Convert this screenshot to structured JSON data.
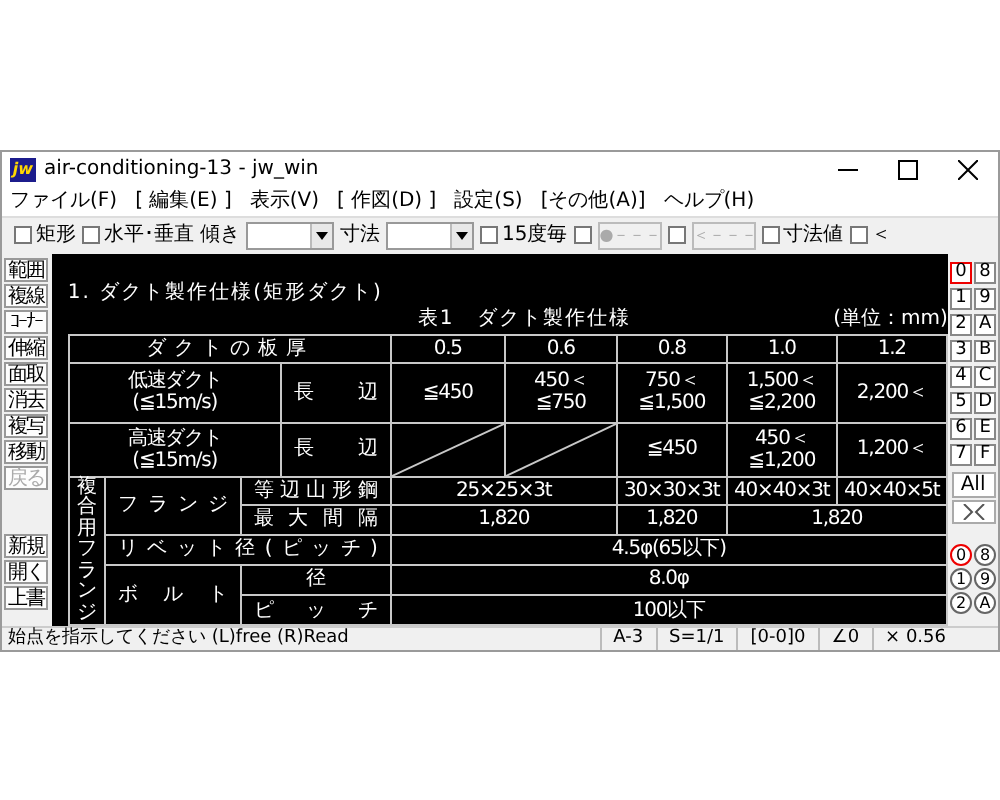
{
  "window": {
    "title": "air-conditioning-13 - jw_win",
    "icon_text": "jw"
  },
  "menu": [
    "ファイル(F)",
    "[ 編集(E) ]",
    "表示(V)",
    "[ 作図(D) ]",
    "設定(S)",
    "[その他(A)]",
    "ヘルプ(H)"
  ],
  "toolbar": [
    {
      "kind": "checkbox",
      "label": "矩形",
      "checked": false
    },
    {
      "kind": "checkbox",
      "label": "水平･垂直",
      "checked": false
    },
    {
      "kind": "label",
      "text": "傾き"
    },
    {
      "kind": "select"
    },
    {
      "kind": "label",
      "text": "寸法"
    },
    {
      "kind": "select"
    },
    {
      "kind": "checkbox",
      "label": "15度毎",
      "checked": false
    },
    {
      "kind": "checkbox",
      "checked": false
    },
    {
      "kind": "button",
      "label": "●－－－",
      "disabled": true
    },
    {
      "kind": "checkbox",
      "checked": false
    },
    {
      "kind": "button",
      "label": "＜－－－",
      "disabled": true
    },
    {
      "kind": "checkbox",
      "label": "寸法値",
      "checked": false
    },
    {
      "kind": "checkbox",
      "label": "＜",
      "checked": false
    }
  ],
  "left_tools": [
    {
      "label": "範囲",
      "disabled": false
    },
    {
      "label": "複線",
      "disabled": false
    },
    {
      "label": "ｺｰﾅｰ",
      "disabled": false
    },
    {
      "label": "伸縮",
      "disabled": false
    },
    {
      "label": "面取",
      "disabled": false
    },
    {
      "label": "消去",
      "disabled": false
    },
    {
      "label": "複写",
      "disabled": false
    },
    {
      "label": "移動",
      "disabled": false
    },
    {
      "label": "戻る",
      "disabled": true
    },
    {
      "label": "新規",
      "disabled": false,
      "kind": "file"
    },
    {
      "label": "開く",
      "disabled": false,
      "kind": "file"
    },
    {
      "label": "上書",
      "disabled": false,
      "kind": "file"
    }
  ],
  "layer_groups": [
    {
      "label": "0",
      "selected": true
    },
    {
      "label": "8",
      "selected": false
    },
    {
      "label": "1",
      "selected": false
    },
    {
      "label": "9",
      "selected": false
    },
    {
      "label": "2",
      "selected": false
    },
    {
      "label": "A",
      "selected": false
    },
    {
      "label": "3",
      "selected": false
    },
    {
      "label": "B",
      "selected": false
    },
    {
      "label": "4",
      "selected": false
    },
    {
      "label": "C",
      "selected": false
    },
    {
      "label": "5",
      "selected": false
    },
    {
      "label": "D",
      "selected": false
    },
    {
      "label": "6",
      "selected": false
    },
    {
      "label": "E",
      "selected": false
    },
    {
      "label": "7",
      "selected": false
    },
    {
      "label": "F",
      "selected": false
    }
  ],
  "all_button": "All",
  "layers": [
    {
      "label": "0",
      "selected": true
    },
    {
      "label": "8",
      "selected": false
    },
    {
      "label": "1",
      "selected": false
    },
    {
      "label": "9",
      "selected": false
    },
    {
      "label": "2",
      "selected": false
    },
    {
      "label": "A",
      "selected": false
    }
  ],
  "drawing": {
    "heading": "1. ダクト製作仕様(矩形ダクト)",
    "table_title": "表1　ダクト製作仕様",
    "unit": "(単位：mm)",
    "rows": [
      [
        {
          "text": "ダクトの板厚",
          "colspan": 4,
          "kind": "label"
        },
        {
          "text": "0.5"
        },
        {
          "text": "0.6"
        },
        {
          "text": "0.8"
        },
        {
          "text": "1.0"
        },
        {
          "text": "1.2"
        }
      ],
      [
        {
          "text": "低速ダクト\n(≦15m/s)",
          "colspan": 3
        },
        {
          "text": "長辺",
          "kind": "spread"
        },
        {
          "text": "≦450"
        },
        {
          "text": "450＜\n≦750"
        },
        {
          "text": "750＜\n≦1,500"
        },
        {
          "text": "1,500＜\n≦2,200"
        },
        {
          "text": "2,200＜"
        }
      ],
      [
        {
          "text": "高速ダクト\n(≦15m/s)",
          "colspan": 3
        },
        {
          "text": "長辺",
          "kind": "spread"
        },
        {
          "kind": "diagonal"
        },
        {
          "kind": "diagonal"
        },
        {
          "text": "≦450"
        },
        {
          "text": "450＜\n≦1,200"
        },
        {
          "text": "1,200＜"
        }
      ],
      [
        {
          "text": "複合用フランジ",
          "rowspan": 5,
          "kind": "vertical"
        },
        {
          "text": "フランジ",
          "rowspan": 2,
          "kind": "spread"
        },
        {
          "text": "等辺山形鋼",
          "colspan": 2,
          "kind": "spread"
        },
        {
          "text": "25×25×3t",
          "colspan": 2
        },
        {
          "text": "30×30×3t"
        },
        {
          "text": "40×40×3t"
        },
        {
          "text": "40×40×5t"
        }
      ],
      [
        {
          "text": "最大間隔",
          "colspan": 2,
          "kind": "spread"
        },
        {
          "text": "1,820",
          "colspan": 2
        },
        {
          "text": "1,820"
        },
        {
          "text": "1,820",
          "colspan": 2
        }
      ],
      [
        {
          "text": "リベット径(ピッチ)",
          "colspan": 3,
          "kind": "spread"
        },
        {
          "text": "4.5φ(65以下)",
          "colspan": 5
        }
      ],
      [
        {
          "text": "ボルト",
          "rowspan": 2,
          "kind": "spread"
        },
        {
          "text": "径",
          "colspan": 2
        },
        {
          "text": "8.0φ",
          "colspan": 5
        }
      ],
      [
        {
          "text": "ピッチ",
          "colspan": 2,
          "kind": "spread"
        },
        {
          "text": "100以下",
          "colspan": 5
        }
      ]
    ]
  },
  "status_bar": {
    "message": "始点を指示してください (L)free (R)Read",
    "fields": [
      "A-3",
      "S=1/1",
      "[0-0]0",
      "∠0",
      "× 0.56"
    ]
  }
}
